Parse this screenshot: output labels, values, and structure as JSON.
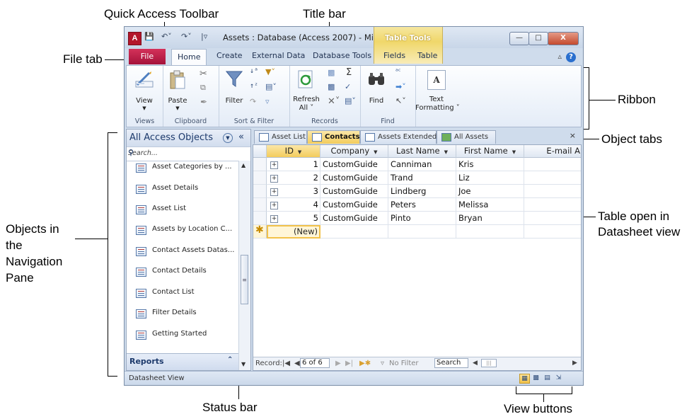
{
  "callouts": {
    "quick_access_toolbar": "Quick Access Toolbar",
    "title_bar": "Title bar",
    "file_tab": "File tab",
    "ribbon": "Ribbon",
    "object_tabs": "Object tabs",
    "objects_nav_1": "Objects in",
    "objects_nav_2": "the",
    "objects_nav_3": "Navigation",
    "objects_nav_4": "Pane",
    "table_open_1": "Table open in",
    "table_open_2": "Datasheet view",
    "status_bar": "Status bar",
    "view_buttons": "View buttons"
  },
  "window": {
    "app_icon": "A",
    "title": "Assets : Database (Access 2007) - Mi...",
    "contextual_tab": "Table Tools",
    "minimize": "—",
    "maximize": "□",
    "close": "X"
  },
  "ribbon_tabs": {
    "file": "File",
    "home": "Home",
    "create": "Create",
    "external_data": "External Data",
    "database_tools": "Database Tools",
    "fields": "Fields",
    "table": "Table"
  },
  "ribbon": {
    "view": "View",
    "paste": "Paste",
    "filter": "Filter",
    "refresh_1": "Refresh",
    "refresh_2": "All ˅",
    "find": "Find",
    "text_formatting_1": "Text",
    "text_formatting_2": "Formatting ˅",
    "groups": {
      "views": "Views",
      "clipboard": "Clipboard",
      "sort_filter": "Sort & Filter",
      "records": "Records",
      "find": "Find"
    }
  },
  "nav_pane": {
    "title": "All Access Objects",
    "search_placeholder": "Search...",
    "items": [
      "Asset Categories by ...",
      "Asset Details",
      "Asset List",
      "Assets by Location C...",
      "Contact Assets Datas...",
      "Contact Details",
      "Contact List",
      "Filter Details",
      "Getting Started"
    ],
    "section_reports": "Reports"
  },
  "object_tabs": [
    "Asset List",
    "Contacts",
    "Assets Extended",
    "All Assets"
  ],
  "datasheet": {
    "columns": [
      "ID",
      "Company",
      "Last Name",
      "First Name",
      "E-mail A"
    ],
    "rows": [
      {
        "id": "1",
        "company": "CustomGuide",
        "last": "Canniman",
        "first": "Kris"
      },
      {
        "id": "2",
        "company": "CustomGuide",
        "last": "Trand",
        "first": "Liz"
      },
      {
        "id": "3",
        "company": "CustomGuide",
        "last": "Lindberg",
        "first": "Joe"
      },
      {
        "id": "4",
        "company": "CustomGuide",
        "last": "Peters",
        "first": "Melissa"
      },
      {
        "id": "5",
        "company": "CustomGuide",
        "last": "Pinto",
        "first": "Bryan"
      }
    ],
    "new_row_label": "(New)"
  },
  "record_nav": {
    "label": "Record:",
    "position": "6 of 6",
    "filter": "No Filter",
    "search": "Search"
  },
  "status_bar": {
    "text": "Datasheet View"
  },
  "colors": {
    "file_tab": "#b8163f",
    "active_tab": "#f3cc5c",
    "window_frame": "#cfdcec"
  }
}
